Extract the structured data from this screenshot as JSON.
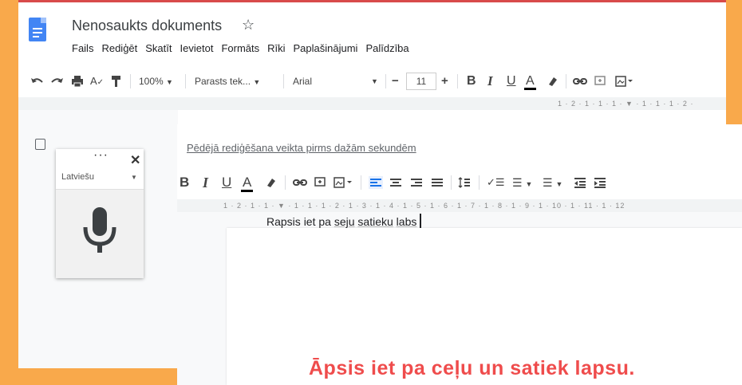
{
  "app": {
    "doc_title": "Nenosaukts dokuments",
    "star_glyph": "☆"
  },
  "menu": [
    "Fails",
    "Rediģēt",
    "Skatīt",
    "Ievietot",
    "Formāts",
    "Rīki",
    "Paplašinājumi",
    "Palīdzība"
  ],
  "toolbar": {
    "zoom": "100%",
    "style": "Parasts tek...",
    "font": "Arial",
    "font_size": "11",
    "minus": "−",
    "plus": "+"
  },
  "ruler_top": "1 · 2 · 1 · 1 · 1 · ▼ · 1 · 1 · 1 · 2 ·",
  "ruler_front": "1 · 2 · 1 · 1 · ▼ · 1 · 1 · 1 · 2 · 1 · 3 · 1 · 4 · 1 · 5 · 1 · 6 · 1 · 7 · 1 · 8 · 1 · 9 · 1 · 10 · 1 · 11 · 1 · 12",
  "voice_panel": {
    "dots": "···",
    "close": "✕",
    "language": "Latviešu"
  },
  "last_edit": "Pēdējā rediģēšana veikta pirms dažām sekundēm",
  "document": {
    "w1": "Rapsis",
    "w2": "iet",
    "w3": "pa",
    "w4": "seju",
    "w5": "satieku",
    "w6": "labs"
  },
  "caption": "Āpsis iet pa ceļu un satiek lapsu.",
  "colors": {
    "background": "#f9a94b",
    "caption": "#ef4c4c",
    "docs_blue": "#4285f4"
  }
}
